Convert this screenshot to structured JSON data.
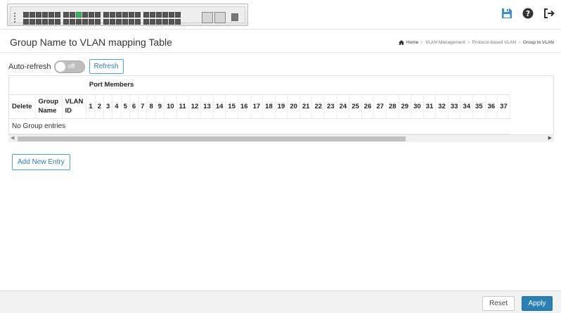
{
  "header": {
    "icons": [
      "save-icon",
      "help-icon",
      "logout-icon"
    ],
    "accent": "#3a8fd6"
  },
  "page": {
    "title": "Group Name to VLAN mapping Table",
    "breadcrumb": [
      "Home",
      "VLAN Management",
      "Protocol-based VLAN",
      "Group to VLAN"
    ]
  },
  "toolbar": {
    "auto_refresh_label": "Auto-refresh",
    "toggle_state": "off",
    "refresh_label": "Refresh"
  },
  "table": {
    "group_header": "Port Members",
    "columns": [
      "Delete",
      "Group Name",
      "VLAN ID"
    ],
    "ports": [
      "1",
      "2",
      "3",
      "4",
      "5",
      "6",
      "7",
      "8",
      "9",
      "10",
      "11",
      "12",
      "13",
      "14",
      "15",
      "16",
      "17",
      "18",
      "19",
      "20",
      "21",
      "22",
      "23",
      "24",
      "25",
      "26",
      "27",
      "28",
      "29",
      "30",
      "31",
      "32",
      "33",
      "34",
      "35",
      "36",
      "37"
    ],
    "empty_message": "No Group entries"
  },
  "actions": {
    "add_label": "Add New Entry",
    "reset_label": "Reset",
    "apply_label": "Apply"
  }
}
